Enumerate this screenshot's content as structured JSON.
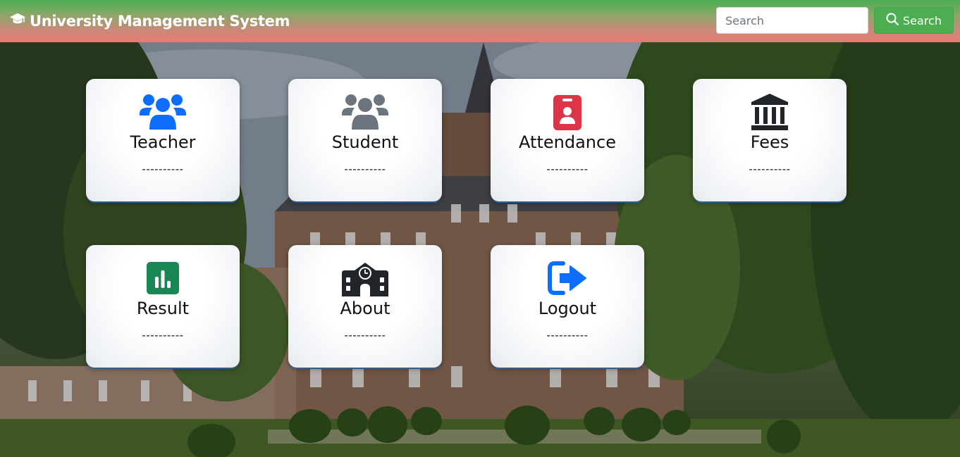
{
  "navbar": {
    "brand": "University Management System",
    "brand_icon": "graduation-cap-icon",
    "search_placeholder": "Search",
    "search_value": "",
    "search_button_label": "Search",
    "search_button_icon": "search-icon",
    "colors": {
      "navbar_top": "#4caf50",
      "navbar_bottom": "#e77a72",
      "search_button": "#4cae50"
    }
  },
  "cards": [
    {
      "title": "Teacher",
      "subtitle": "----------",
      "icon": "users-icon",
      "icon_color": "#0d6efd"
    },
    {
      "title": "Student",
      "subtitle": "----------",
      "icon": "users-icon",
      "icon_color": "#6c757d"
    },
    {
      "title": "Attendance",
      "subtitle": "----------",
      "icon": "id-badge-icon",
      "icon_color": "#dc3545"
    },
    {
      "title": "Fees",
      "subtitle": "----------",
      "icon": "bank-icon",
      "icon_color": "#212529"
    },
    {
      "title": "Result",
      "subtitle": "----------",
      "icon": "bar-chart-icon",
      "icon_color": "#198754"
    },
    {
      "title": "About",
      "subtitle": "----------",
      "icon": "school-icon",
      "icon_color": "#212529"
    },
    {
      "title": "Logout",
      "subtitle": "----------",
      "icon": "logout-icon",
      "icon_color": "#0d6efd"
    }
  ]
}
